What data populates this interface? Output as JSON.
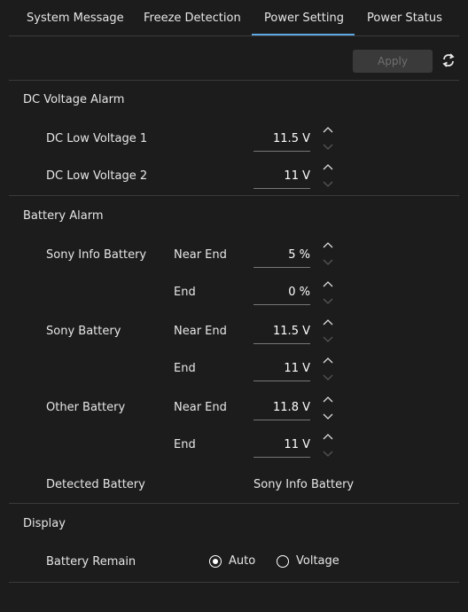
{
  "tabs": [
    {
      "label": "System Message"
    },
    {
      "label": "Freeze Detection"
    },
    {
      "label": "Power Setting"
    },
    {
      "label": "Power Status"
    }
  ],
  "toolbar": {
    "apply_label": "Apply"
  },
  "dc_alarm": {
    "title": "DC Voltage Alarm",
    "rows": [
      {
        "label": "DC Low Voltage 1",
        "value": "11.5 V"
      },
      {
        "label": "DC Low Voltage 2",
        "value": "11 V"
      }
    ]
  },
  "battery_alarm": {
    "title": "Battery Alarm",
    "groups": [
      {
        "name": "Sony Info Battery",
        "near_end_label": "Near End",
        "near_end_value": "5 %",
        "end_label": "End",
        "end_value": "0 %"
      },
      {
        "name": "Sony Battery",
        "near_end_label": "Near End",
        "near_end_value": "11.5 V",
        "end_label": "End",
        "end_value": "11 V"
      },
      {
        "name": "Other Battery",
        "near_end_label": "Near End",
        "near_end_value": "11.8 V",
        "end_label": "End",
        "end_value": "11 V"
      }
    ],
    "detected_label": "Detected Battery",
    "detected_value": "Sony Info Battery"
  },
  "display": {
    "title": "Display",
    "battery_remain_label": "Battery Remain",
    "options": [
      {
        "label": "Auto",
        "selected": true
      },
      {
        "label": "Voltage",
        "selected": false
      }
    ]
  }
}
